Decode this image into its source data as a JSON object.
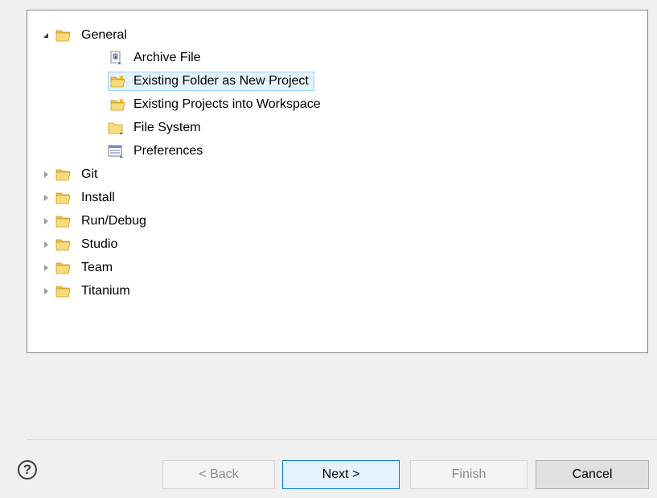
{
  "tree": {
    "items": [
      {
        "label": "General",
        "icon": "folder-open-icon",
        "state": "expanded",
        "level": 0
      },
      {
        "label": "Archive File",
        "icon": "archive-file-icon",
        "state": "leaf",
        "level": 1
      },
      {
        "label": "Existing Folder as New Project",
        "icon": "new-project-folder-icon",
        "state": "leaf",
        "level": 1,
        "selected": true
      },
      {
        "label": "Existing Projects into Workspace",
        "icon": "new-project-folder-icon",
        "state": "leaf",
        "level": 1
      },
      {
        "label": "File System",
        "icon": "folder-icon",
        "state": "leaf",
        "level": 1
      },
      {
        "label": "Preferences",
        "icon": "preferences-icon",
        "state": "leaf",
        "level": 1
      },
      {
        "label": "Git",
        "icon": "folder-open-icon",
        "state": "collapsed",
        "level": 0
      },
      {
        "label": "Install",
        "icon": "folder-open-icon",
        "state": "collapsed",
        "level": 0
      },
      {
        "label": "Run/Debug",
        "icon": "folder-open-icon",
        "state": "collapsed",
        "level": 0
      },
      {
        "label": "Studio",
        "icon": "folder-open-icon",
        "state": "collapsed",
        "level": 0
      },
      {
        "label": "Team",
        "icon": "folder-open-icon",
        "state": "collapsed",
        "level": 0
      },
      {
        "label": "Titanium",
        "icon": "folder-open-icon",
        "state": "collapsed",
        "level": 0
      }
    ]
  },
  "buttons": {
    "help": "?",
    "back": "< Back",
    "next": "Next >",
    "finish": "Finish",
    "cancel": "Cancel"
  },
  "colors": {
    "selection_bg": "#e5f3ff",
    "selection_border": "#99d1ff",
    "folder": "#f5d56b"
  }
}
